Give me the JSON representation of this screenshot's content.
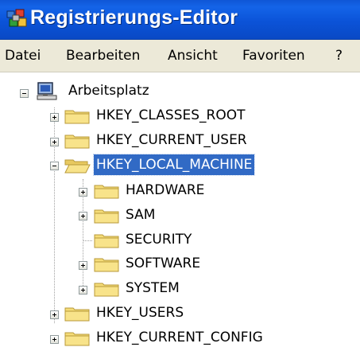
{
  "window": {
    "title": "Registrierungs-Editor",
    "title_icon": "registry-editor-icon"
  },
  "menu": [
    "Datei",
    "Bearbeiten",
    "Ansicht",
    "Favoriten",
    "?"
  ],
  "tree": {
    "root": {
      "label": "Arbeitsplatz",
      "icon": "computer-icon",
      "expanded": true
    },
    "hives": [
      {
        "label": "HKEY_CLASSES_ROOT",
        "expanded": false
      },
      {
        "label": "HKEY_CURRENT_USER",
        "expanded": false
      },
      {
        "label": "HKEY_LOCAL_MACHINE",
        "expanded": true,
        "selected": true,
        "children": [
          {
            "label": "HARDWARE",
            "expandable": true
          },
          {
            "label": "SAM",
            "expandable": true
          },
          {
            "label": "SECURITY",
            "expandable": false
          },
          {
            "label": "SOFTWARE",
            "expandable": true
          },
          {
            "label": "SYSTEM",
            "expandable": true
          }
        ]
      },
      {
        "label": "HKEY_USERS",
        "expanded": false
      },
      {
        "label": "HKEY_CURRENT_CONFIG",
        "expanded": false
      }
    ]
  },
  "colors": {
    "titlebar": "#0b53d8",
    "menubar": "#ece9d8",
    "selection": "#316ac5",
    "folder": "#f5dc78"
  }
}
